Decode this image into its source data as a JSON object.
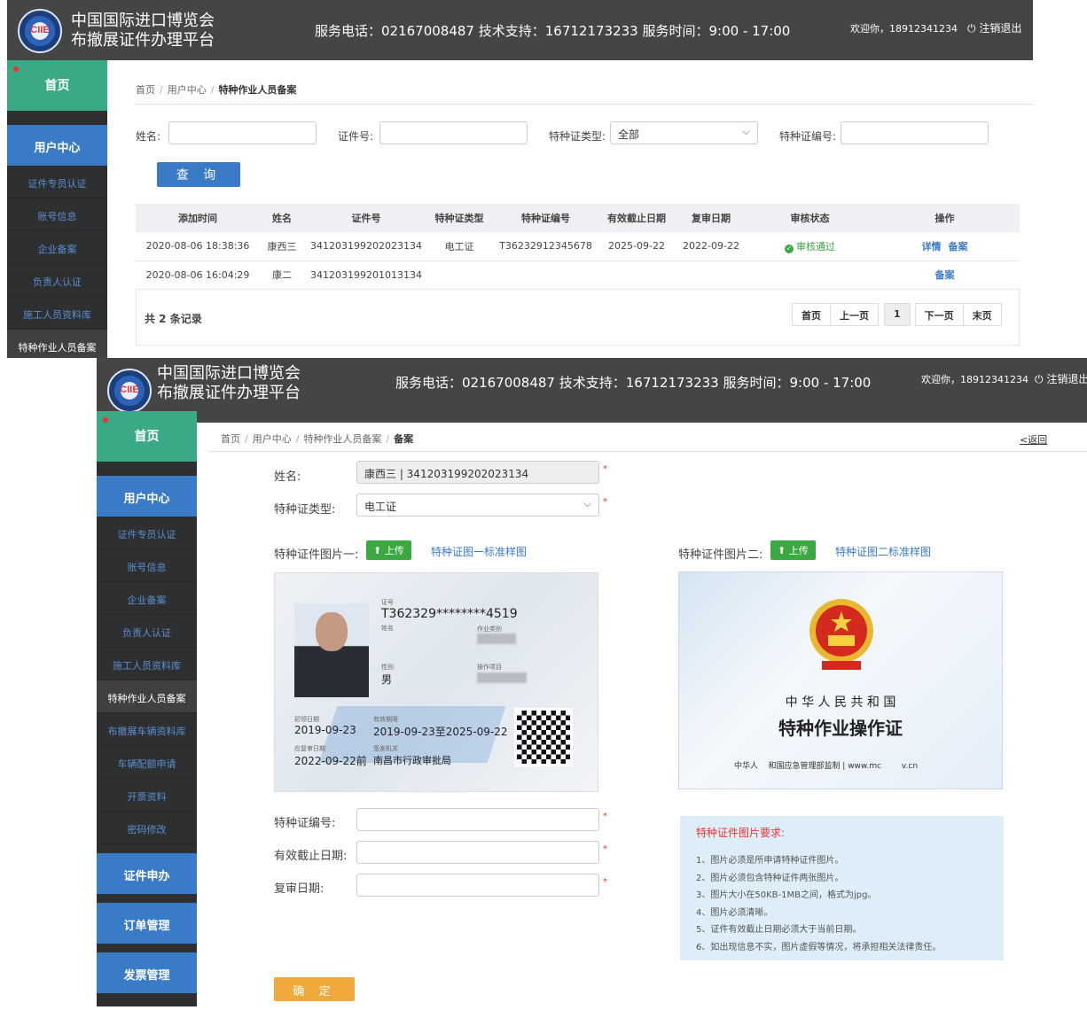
{
  "header": {
    "brand_line1": "中国国际进口博览会",
    "brand_line2": "布撤展证件办理平台",
    "logo_text": "CIIE",
    "service_text": "服务电话：02167008487  技术支持：16712173233   服务时间：9:00 - 17:00",
    "welcome": "欢迎你，18912341234",
    "logout": "注销退出"
  },
  "sidebar": {
    "home": "首页",
    "user_center": "用户中心",
    "items": [
      "证件专员认证",
      "账号信息",
      "企业备案",
      "负责人认证",
      "施工人员资料库",
      "特种作业人员备案",
      "布撤展车辆资料库",
      "车辆配额申请",
      "开票资料",
      "密码修改"
    ],
    "cert_apply": "证件申办",
    "order_mgmt": "订单管理",
    "invoice_mgmt": "发票管理"
  },
  "list_page": {
    "breadcrumb": [
      "首页",
      "用户中心",
      "特种作业人员备案"
    ],
    "filters": {
      "name_label": "姓名:",
      "id_label": "证件号:",
      "type_label": "特种证类型:",
      "type_value": "全部",
      "number_label": "特种证编号:"
    },
    "query_button": "查 询",
    "columns": [
      "添加时间",
      "姓名",
      "证件号",
      "特种证类型",
      "特种证编号",
      "有效截止日期",
      "复审日期",
      "审核状态",
      "操作"
    ],
    "rows": [
      {
        "time": "2020-08-06 18:38:36",
        "name": "康西三",
        "id": "341203199202023134",
        "type": "电工证",
        "number": "T36232912345678",
        "expiry": "2025-09-22",
        "review": "2022-09-22",
        "status": "审核通过",
        "op1": "详情",
        "op2": "备案"
      },
      {
        "time": "2020-08-06 16:04:29",
        "name": "康二",
        "id": "341203199201013134",
        "type": "",
        "number": "",
        "expiry": "",
        "review": "",
        "status": "",
        "op1": "",
        "op2": "备案"
      }
    ],
    "total": "共 2 条记录",
    "pager": {
      "first": "首页",
      "prev": "上一页",
      "current": "1",
      "next": "下一页",
      "last": "末页"
    }
  },
  "form_page": {
    "breadcrumb": [
      "首页",
      "用户中心",
      "特种作业人员备案",
      "备案"
    ],
    "back": "<返回",
    "name_label": "姓名:",
    "name_value": "康西三 | 341203199202023134",
    "type_label": "特种证类型:",
    "type_value": "电工证",
    "img1_label": "特种证件图片一:",
    "img2_label": "特种证件图片二:",
    "upload": "上传",
    "sample1": "特种证图一标准样图",
    "sample2": "特种证图二标准样图",
    "card1": {
      "cert_no_label": "证号",
      "cert_no": "T362329********4519",
      "name_label": "姓名",
      "job_label": "作业类别",
      "sex_label": "性别",
      "sex": "男",
      "op_label": "操作项目",
      "first_label": "初领日期",
      "first": "2019-09-23",
      "valid_label": "有效期限",
      "valid": "2019-09-23至2025-09-22",
      "review_label": "应复审日期",
      "review": "2022-09-22前",
      "issuer_label": "签发机关",
      "issuer": "南昌市行政审批局"
    },
    "card2": {
      "country": "中 华 人 民 共 和 国",
      "title": "特种作业操作证",
      "footer": "中华人    和国应急管理部监制 | www.mc        v.cn"
    },
    "number_label": "特种证编号:",
    "expiry_label": "有效截止日期:",
    "review_label": "复审日期:",
    "req_title": "特种证件图片要求:",
    "requirements": [
      "1、图片必须是所申请特种证件图片。",
      "2、图片必须包含特种证件两张图片。",
      "3、图片大小在50KB-1MB之间，格式为jpg。",
      "4、图片必须清晰。",
      "5、证件有效截止日期必须大于当前日期。",
      "6、如出现信息不实，图片虚假等情况，将承担相关法律责任。"
    ],
    "submit": "确 定"
  }
}
